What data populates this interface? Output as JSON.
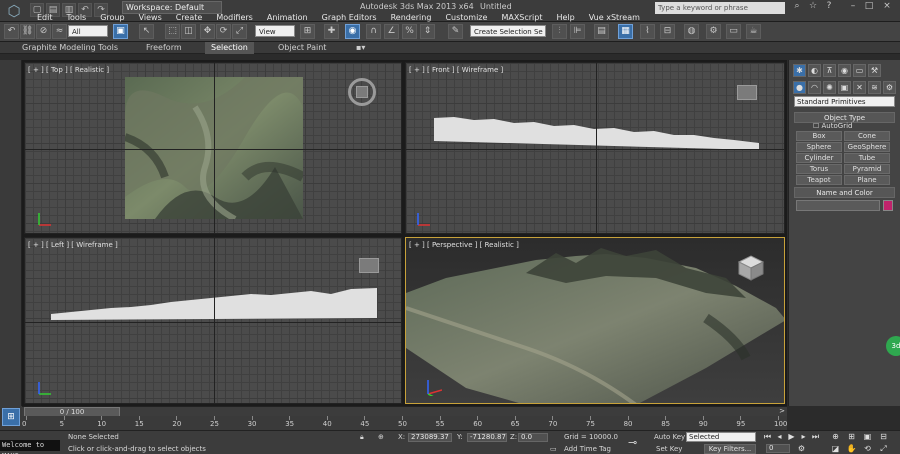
{
  "app": {
    "title": "Autodesk 3ds Max  2013 x64",
    "file": "Untitled",
    "workspace": "Workspace: Default",
    "search_placeholder": "Type a keyword or phrase"
  },
  "menus": [
    "Edit",
    "Tools",
    "Group",
    "Views",
    "Create",
    "Modifiers",
    "Animation",
    "Graph Editors",
    "Rendering",
    "Customize",
    "MAXScript",
    "Help",
    "Vue xStream"
  ],
  "toolbar": {
    "filter": "All",
    "ref_coord": "View",
    "selection_set": "Create Selection Se"
  },
  "ribbon_tabs": [
    "Graphite Modeling Tools",
    "Freeform",
    "Selection",
    "Object Paint"
  ],
  "viewports": {
    "top": "[ + ] [ Top ] [ Realistic ]",
    "front": "[ + ] [ Front ] [ Wireframe ]",
    "left": "[ + ] [ Left ] [ Wireframe ]",
    "perspective": "[ + ] [ Perspective ] [ Realistic ]"
  },
  "command_panel": {
    "category": "Standard Primitives",
    "object_type_title": "Object Type",
    "autogrid": "AutoGrid",
    "buttons": [
      "Box",
      "Cone",
      "Sphere",
      "GeoSphere",
      "Cylinder",
      "Tube",
      "Torus",
      "Pyramid",
      "Teapot",
      "Plane"
    ],
    "name_color_title": "Name and Color",
    "object_color": "#c0236b"
  },
  "timeline": {
    "frame_display": "0 / 100",
    "ticks": [
      "0",
      "5",
      "10",
      "15",
      "20",
      "25",
      "30",
      "35",
      "40",
      "45",
      "50",
      "55",
      "60",
      "65",
      "70",
      "75",
      "80",
      "85",
      "90",
      "95",
      "100"
    ]
  },
  "status": {
    "listener": "Welcome to MAXS",
    "selection": "None Selected",
    "prompt": "Click or click-and-drag to select objects",
    "x_label": "X:",
    "x_value": "273089.37",
    "y_label": "Y:",
    "y_value": "-71280.87",
    "z_label": "Z:",
    "z_value": "0.0",
    "grid": "Grid = 10000.0",
    "add_time_tag": "Add Time Tag",
    "auto_key": "Auto Key",
    "set_key": "Set Key",
    "key_mode": "Selected",
    "key_filters": "Key Filters...",
    "frame": "0"
  },
  "colors": {
    "accent": "#3a6fa8",
    "active_viewport": "#c8a23a"
  }
}
